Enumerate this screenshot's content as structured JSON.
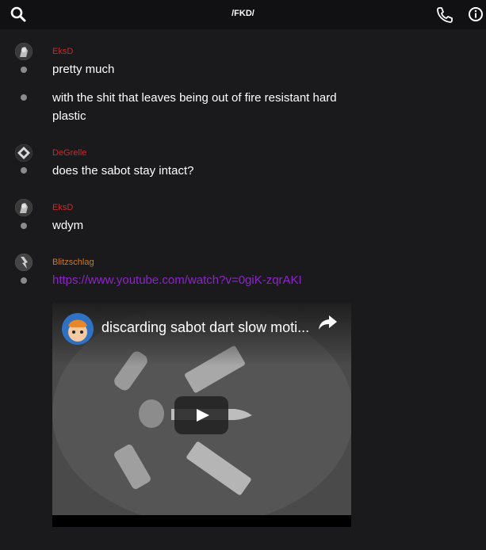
{
  "topbar": {
    "title": "/FKD/"
  },
  "messages": [
    {
      "author": "EksD",
      "author_color": "#c62b2b",
      "lines": [
        "pretty much",
        "with the shit that leaves being out of fire resistant hard plastic"
      ]
    },
    {
      "author": "DeGrelle",
      "author_color": "#c62b2b",
      "lines": [
        "does the sabot stay intact?"
      ]
    },
    {
      "author": "EksD",
      "author_color": "#c62b2b",
      "lines": [
        "wdym"
      ]
    },
    {
      "author": "Blitzschlag",
      "author_color": "#d07a21",
      "link": "https://www.youtube.com/watch?v=0giK-zqrAKI"
    }
  ],
  "embed": {
    "title": "discarding sabot dart slow moti..."
  },
  "icons": [
    "search-icon",
    "phone-icon",
    "info-icon",
    "share-icon",
    "play-icon"
  ]
}
